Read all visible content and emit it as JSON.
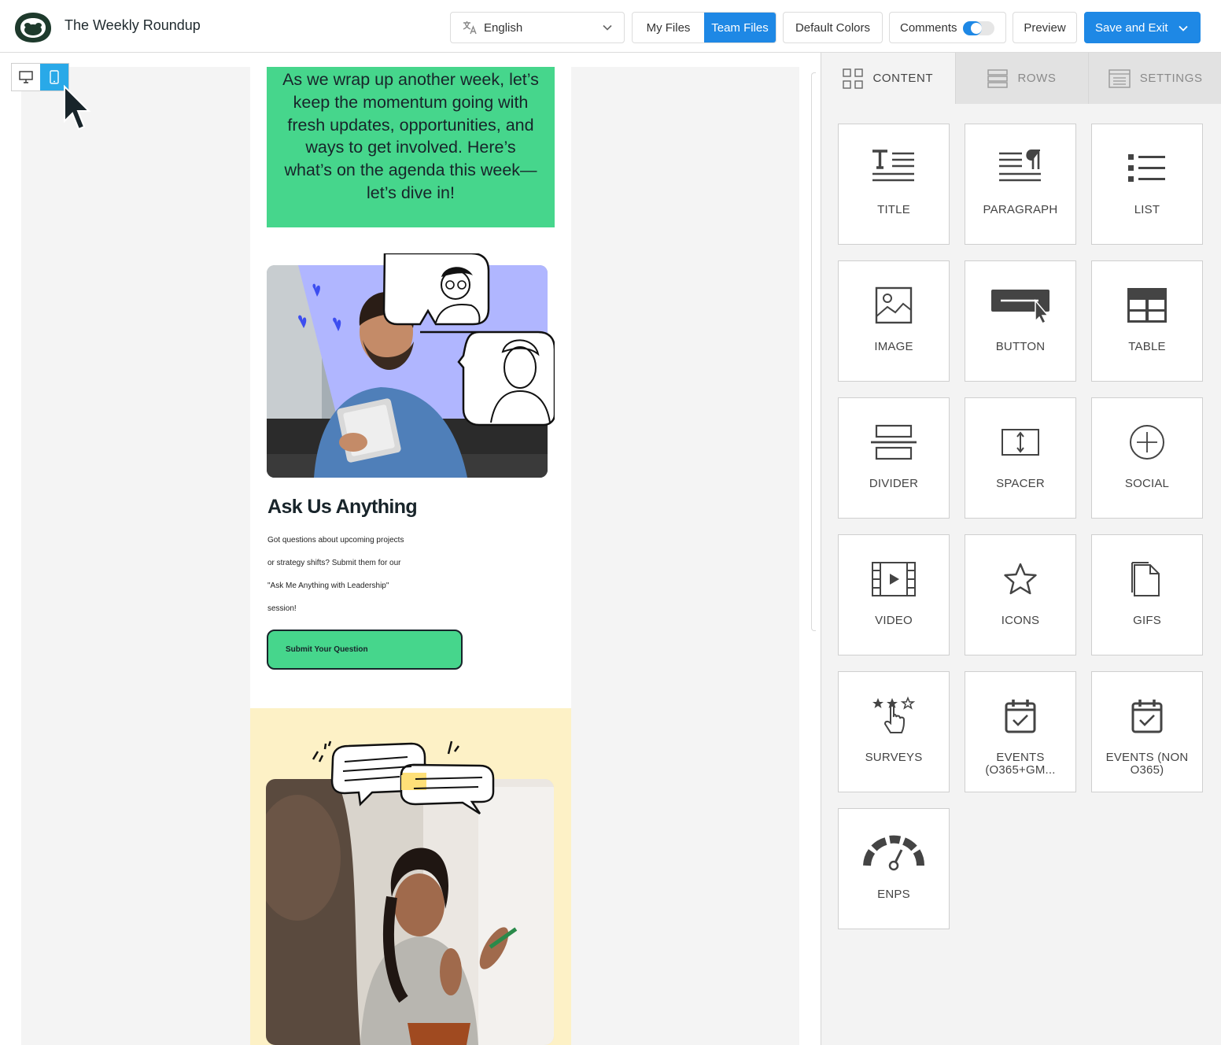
{
  "header": {
    "title": "The Weekly Roundup",
    "language": "English",
    "my_files": "My Files",
    "team_files": "Team Files",
    "default_colors": "Default Colors",
    "comments": "Comments",
    "comments_enabled": true,
    "preview": "Preview",
    "save_exit": "Save and Exit"
  },
  "accent_color": "#1e88e5",
  "email": {
    "intro": "As we wrap up another week, let’s keep the momentum going with fresh updates, opportunities, and ways to get involved. Here’s what’s on the agenda this week—let’s dive in!",
    "section_title": "Ask Us Anything",
    "section_body_lines": [
      "Got questions about upcoming projects",
      "or strategy shifts? Submit them for our",
      "\"Ask Me Anything with Leadership\"",
      "session!"
    ],
    "cta": "Submit Your Question",
    "green_color": "#46d68c",
    "yellow_color": "#fdf1c6"
  },
  "panel": {
    "tabs": [
      {
        "label": "CONTENT",
        "icon": "grid-icon",
        "active": true
      },
      {
        "label": "ROWS",
        "icon": "rows-icon",
        "active": false
      },
      {
        "label": "SETTINGS",
        "icon": "settings-panel-icon",
        "active": false
      }
    ],
    "tiles": [
      {
        "label": "TITLE",
        "icon": "title-icon"
      },
      {
        "label": "PARAGRAPH",
        "icon": "paragraph-icon"
      },
      {
        "label": "LIST",
        "icon": "list-icon"
      },
      {
        "label": "IMAGE",
        "icon": "image-icon"
      },
      {
        "label": "BUTTON",
        "icon": "button-icon"
      },
      {
        "label": "TABLE",
        "icon": "table-icon"
      },
      {
        "label": "DIVIDER",
        "icon": "divider-icon"
      },
      {
        "label": "SPACER",
        "icon": "spacer-icon"
      },
      {
        "label": "SOCIAL",
        "icon": "social-icon"
      },
      {
        "label": "VIDEO",
        "icon": "video-icon"
      },
      {
        "label": "ICONS",
        "icon": "star-icon"
      },
      {
        "label": "GIFS",
        "icon": "gif-icon"
      },
      {
        "label": "SURVEYS",
        "icon": "survey-icon"
      },
      {
        "label": "EVENTS (O365+GM...",
        "icon": "calendar-check-icon"
      },
      {
        "label": "EVENTS (NON O365)",
        "icon": "calendar-check-icon"
      },
      {
        "label": "ENPS",
        "icon": "gauge-icon"
      }
    ]
  }
}
